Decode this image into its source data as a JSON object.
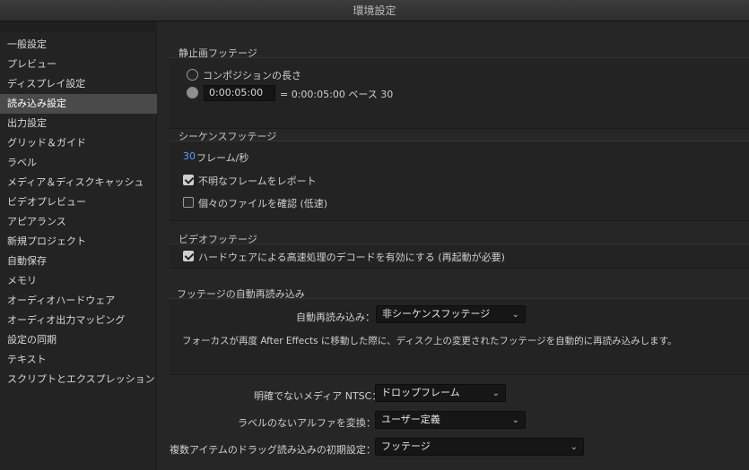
{
  "window": {
    "title": "環境設定"
  },
  "sidebar": {
    "items": [
      {
        "label": "一般設定"
      },
      {
        "label": "プレビュー"
      },
      {
        "label": "ディスプレイ設定"
      },
      {
        "label": "読み込み設定",
        "selected": true
      },
      {
        "label": "出力設定"
      },
      {
        "label": "グリッド＆ガイド"
      },
      {
        "label": "ラベル"
      },
      {
        "label": "メディア＆ディスクキャッシュ"
      },
      {
        "label": "ビデオプレビュー"
      },
      {
        "label": "アピアランス"
      },
      {
        "label": "新規プロジェクト"
      },
      {
        "label": "自動保存"
      },
      {
        "label": "メモリ"
      },
      {
        "label": "オーディオハードウェア"
      },
      {
        "label": "オーディオ出力マッピング"
      },
      {
        "label": "設定の同期"
      },
      {
        "label": "テキスト"
      },
      {
        "label": "スクリプトとエクスプレッション"
      }
    ]
  },
  "still_footage": {
    "title": "静止画フッテージ",
    "option_comp_length": "コンポジションの長さ",
    "duration_value": "0:00:05:00",
    "duration_equals": "= 0:00:05:00 ベース 30"
  },
  "sequence_footage": {
    "title": "シーケンスフッテージ",
    "fps_value": "30",
    "fps_unit": "フレーム/秒",
    "report_missing_frames": "不明なフレームをレポート",
    "verify_individual_files": "個々のファイルを確認 (低速)"
  },
  "video_footage": {
    "title": "ビデオフッテージ",
    "hw_decode": "ハードウェアによる高速処理のデコードを有効にする (再起動が必要)"
  },
  "auto_reload": {
    "title": "フッテージの自動再読み込み",
    "label": "自動再読み込み：",
    "value": "非シーケンスフッテージ",
    "description": "フォーカスが再度 After Effects に移動した際に、ディスク上の変更されたフッテージを自動的に再読み込みします。"
  },
  "bottom_settings": {
    "ntsc_label": "明確でないメディア NTSC：",
    "ntsc_value": "ドロップフレーム",
    "alpha_label": "ラベルのないアルファを変換：",
    "alpha_value": "ユーザー定義",
    "drag_label": "複数アイテムのドラッグ読み込みの初期設定：",
    "drag_value": "フッテージ"
  },
  "icons": {
    "dropdown": "chevron-down-icon"
  }
}
